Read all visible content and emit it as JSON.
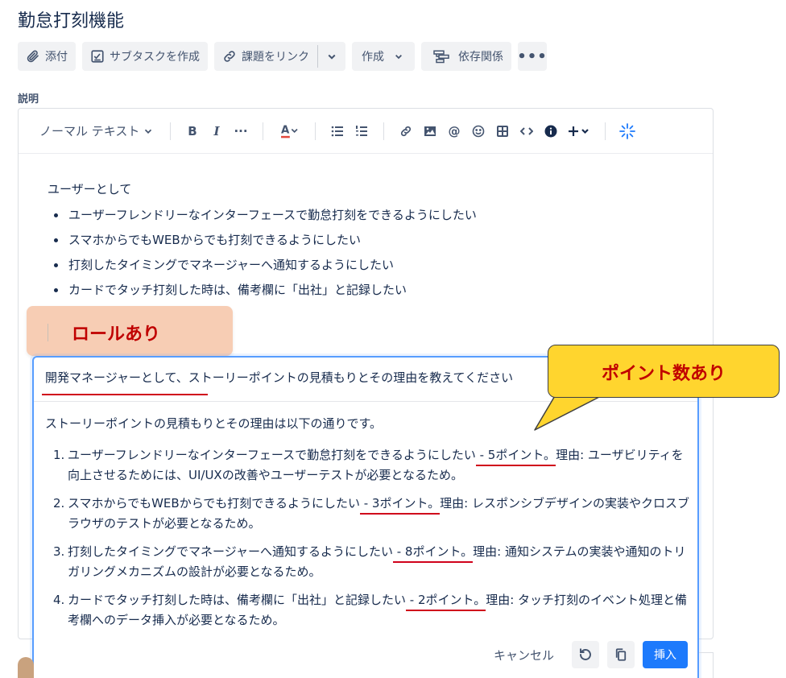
{
  "issue": {
    "title": "勤怠打刻機能"
  },
  "actions": {
    "attach": "添付",
    "subtask": "サブタスクを作成",
    "link": "課題をリンク",
    "create": "作成",
    "dependency": "依存関係"
  },
  "description": {
    "label": "説明",
    "text_style": "ノーマル テキスト",
    "intro": "ユーザーとして",
    "bullets": [
      "ユーザーフレンドリーなインターフェースで勤怠打刻をできるようにしたい",
      "スマホからでもWEBからでも打刻できるようにしたい",
      "打刻したタイミングでマネージャーへ通知するようにしたい",
      "カードでタッチ打刻した時は、備考欄に「出社」と記録したい"
    ]
  },
  "annotations": {
    "role": "ロールあり",
    "points": "ポイント数あり"
  },
  "ai": {
    "prompt": "開発マネージャーとして、ストーリーポイントの見積もりとその理由を教えてください",
    "intro": "ストーリーポイントの見積もりとその理由は以下の通りです。",
    "items": [
      {
        "num": "1.",
        "story": "ユーザーフレンドリーなインターフェースで勤怠打刻をできるようにしたい",
        "points": " - 5ポイント。",
        "reason": "理由: ユーザビリティを向上させるためには、UI/UXの改善やユーザーテストが必要となるため。"
      },
      {
        "num": "2.",
        "story": "スマホからでもWEBからでも打刻できるようにしたい",
        "points": " - 3ポイント。",
        "reason": "理由: レスポンシブデザインの実装やクロスブラウザのテストが必要となるため。"
      },
      {
        "num": "3.",
        "story": "打刻したタイミングでマネージャーへ通知するようにしたい",
        "points": " - 8ポイント。",
        "reason": "理由: 通知システムの実装や通知のトリガリングメカニズムの設計が必要となるため。"
      },
      {
        "num": "4.",
        "story": "カードでタッチ打刻した時は、備考欄に「出社」と記録したい",
        "points": " - 2ポイント。",
        "reason": "理由: タッチ打刻のイベント処理と備考欄へのデータ挿入が必要となるため。"
      }
    ],
    "cancel": "キャンセル",
    "insert": "挿入"
  },
  "colors": {
    "accent": "#1d7afc",
    "annotation_red": "#c00000",
    "callout_yellow": "#ffd52e",
    "role_bg": "#f7cdb4"
  }
}
